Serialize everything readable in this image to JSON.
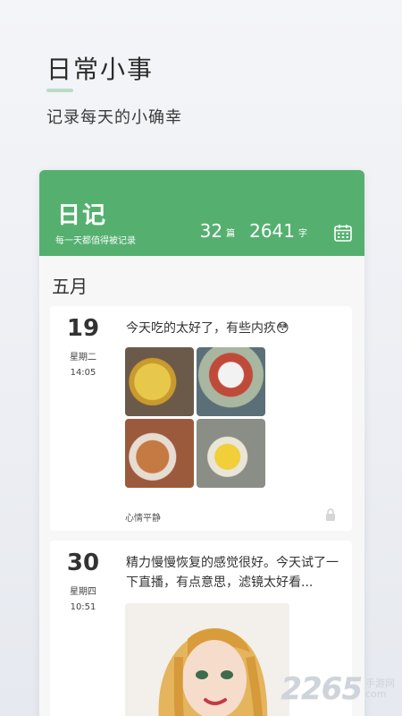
{
  "hero": {
    "title": "日常小事",
    "subtitle": "记录每天的小确幸"
  },
  "header": {
    "title": "日记",
    "subtitle": "每一天都值得被记录",
    "entries_count": "32",
    "entries_unit": "篇",
    "words_count": "2641",
    "words_unit": "字",
    "accent_color": "#55b070"
  },
  "month_label": "五月",
  "entries": [
    {
      "day": "19",
      "weekday": "星期二",
      "time": "14:05",
      "text": "今天吃的太好了，有些内疚😳",
      "mood": "心情平静"
    },
    {
      "day": "30",
      "weekday": "星期四",
      "time": "10:51",
      "text": "精力慢慢恢复的感觉很好。今天试了一下直播，有点意思，滤镜太好看..."
    }
  ],
  "watermark": {
    "number": "2265",
    "cn": "手游网",
    "domain": "com"
  }
}
